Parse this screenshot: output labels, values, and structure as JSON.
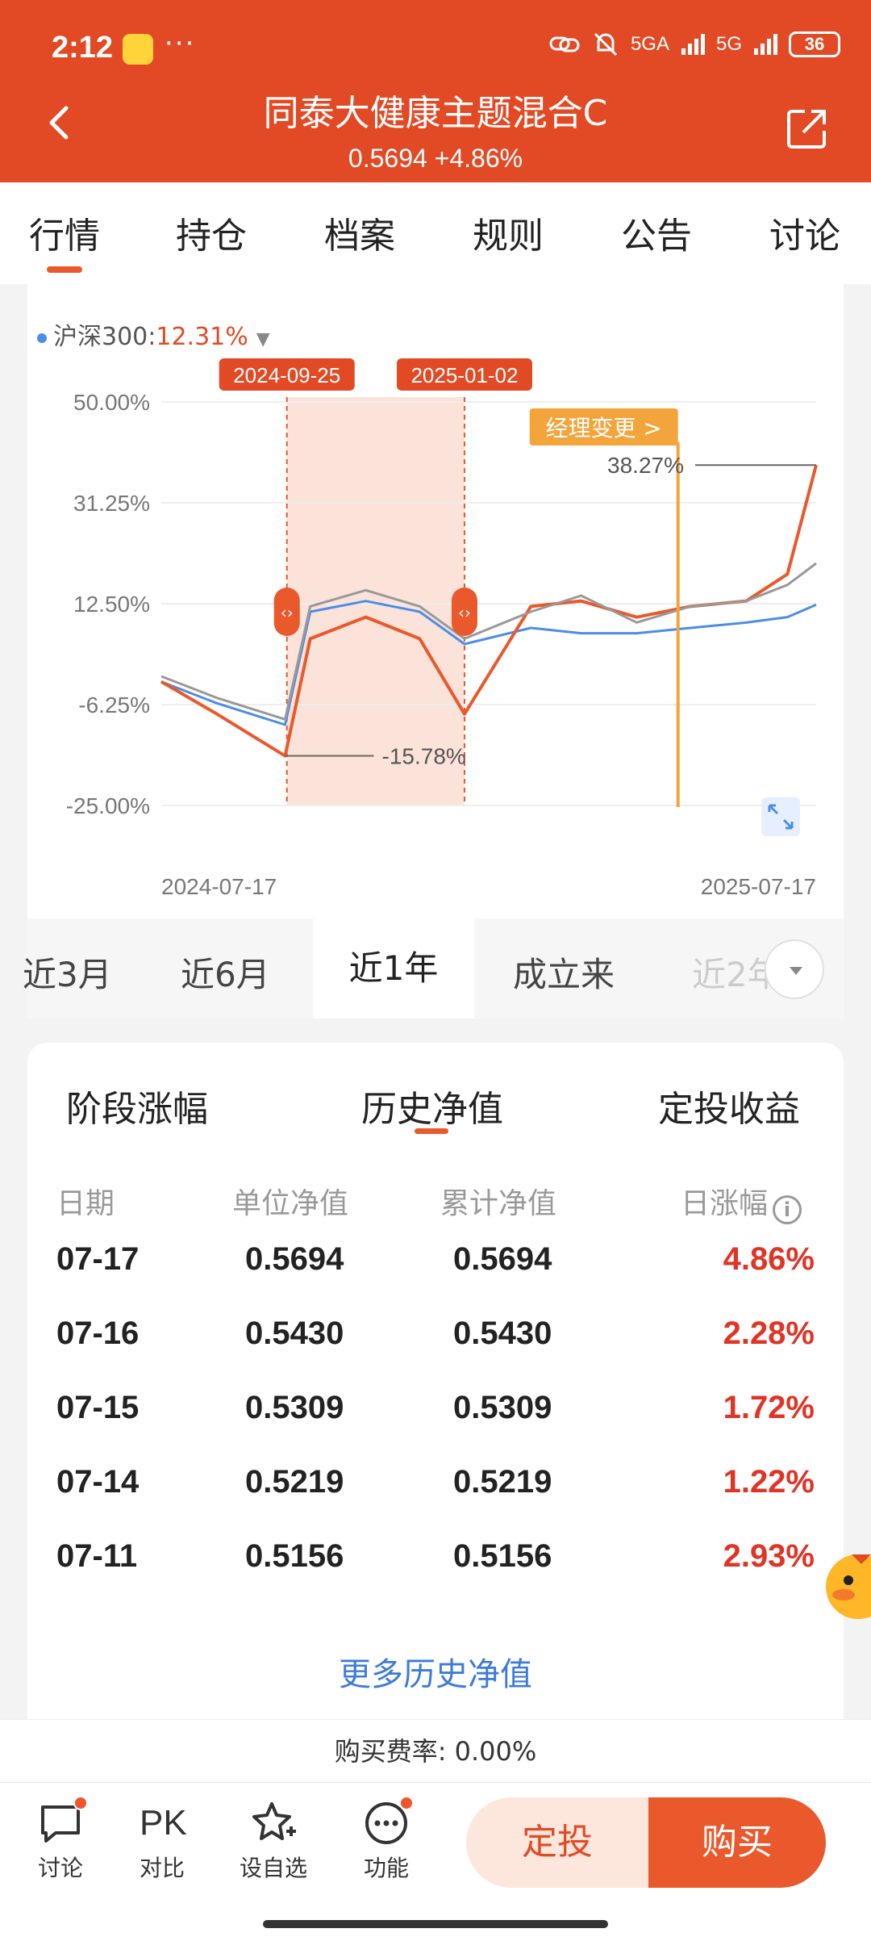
{
  "status_bar": {
    "time": "2:12",
    "dots": "···",
    "signal1": "5GA",
    "signal2": "5G",
    "battery": "36"
  },
  "header": {
    "title": "同泰大健康主题混合C",
    "subtitle": "0.5694  +4.86%"
  },
  "tabs": [
    "行情",
    "持仓",
    "档案",
    "规则",
    "公告",
    "讨论"
  ],
  "active_tab": 0,
  "legend": {
    "name": "沪深300:",
    "value": "12.31%"
  },
  "chart": {
    "y_ticks": [
      "50.00%",
      "31.25%",
      "12.50%",
      "-6.25%",
      "-25.00%"
    ],
    "x_start": "2024-07-17",
    "x_end": "2025-07-17",
    "range_start": "2024-09-25",
    "range_end": "2025-01-02",
    "annotation_manager": "经理变更 >",
    "max_label": "38.27%",
    "min_label": "-15.78%"
  },
  "chart_data": {
    "type": "line",
    "ylim": [
      -25,
      50
    ],
    "x": [
      "2024-07-17",
      "2024-08-17",
      "2024-09-24",
      "2024-10-08",
      "2024-11-08",
      "2024-12-08",
      "2025-01-02",
      "2025-02-08",
      "2025-03-08",
      "2025-04-08",
      "2025-05-08",
      "2025-06-08",
      "2025-07-01",
      "2025-07-17"
    ],
    "series": [
      {
        "name": "沪深300",
        "color": "#4c8de8",
        "values": [
          -2,
          -6,
          -10,
          11,
          13,
          11,
          5,
          8,
          7,
          7,
          8,
          9,
          10,
          12.31
        ]
      },
      {
        "color": "#e9592c",
        "values": [
          -2,
          -8,
          -15.78,
          6,
          10,
          6,
          -8,
          12,
          13,
          10,
          12,
          13,
          18,
          38.27
        ]
      },
      {
        "color": "#999999",
        "values": [
          -1,
          -5,
          -9,
          12,
          15,
          12,
          6,
          11,
          14,
          9,
          12,
          13,
          16,
          20
        ]
      }
    ]
  },
  "periods": [
    "近3月",
    "近6月",
    "近1年",
    "成立来",
    "近2年"
  ],
  "active_period": 2,
  "history": {
    "subtabs": [
      "阶段涨幅",
      "历史净值",
      "定投收益"
    ],
    "headers": [
      "日期",
      "单位净值",
      "累计净值",
      "日涨幅"
    ],
    "rows": [
      {
        "date": "07-17",
        "nav": "0.5694",
        "acc": "0.5694",
        "chg": "4.86%"
      },
      {
        "date": "07-16",
        "nav": "0.5430",
        "acc": "0.5430",
        "chg": "2.28%"
      },
      {
        "date": "07-15",
        "nav": "0.5309",
        "acc": "0.5309",
        "chg": "1.72%"
      },
      {
        "date": "07-14",
        "nav": "0.5219",
        "acc": "0.5219",
        "chg": "1.22%"
      },
      {
        "date": "07-11",
        "nav": "0.5156",
        "acc": "0.5156",
        "chg": "2.93%"
      }
    ],
    "more": "更多历史净值"
  },
  "fee": "购买费率: 0.00%",
  "bottom": {
    "discuss": "讨论",
    "pk_icon_text": "PK",
    "compare": "对比",
    "watch": "设自选",
    "functions": "功能",
    "regular_invest": "定投",
    "buy": "购买"
  }
}
